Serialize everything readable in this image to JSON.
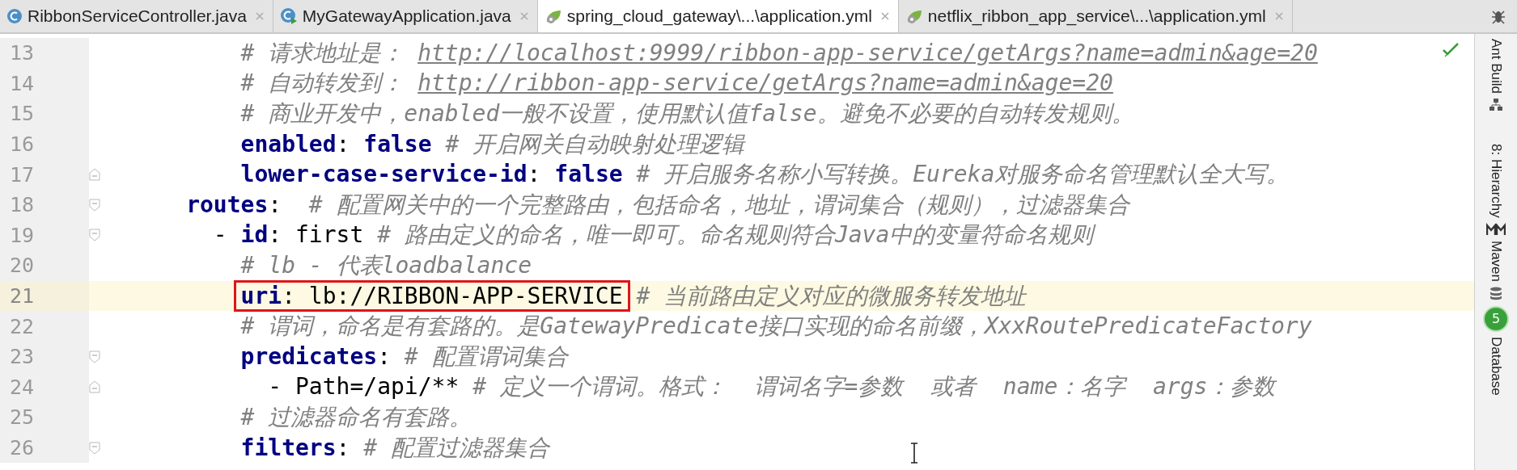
{
  "tabs": [
    {
      "label": "RibbonServiceController.java",
      "kind": "java",
      "selected": false
    },
    {
      "label": "MyGatewayApplication.java",
      "kind": "boot",
      "selected": false
    },
    {
      "label": "spring_cloud_gateway\\...\\application.yml",
      "kind": "yaml",
      "selected": true
    },
    {
      "label": "netflix_ribbon_app_service\\...\\application.yml",
      "kind": "yaml",
      "selected": false
    }
  ],
  "editor": {
    "lines": [
      {
        "number": "13",
        "current": false,
        "segments": [
          {
            "kind": "comment",
            "text": "          # 请求地址是： "
          },
          {
            "kind": "link",
            "text": "http://localhost:9999/ribbon-app-service/getArgs?name=admin&age=20"
          }
        ]
      },
      {
        "number": "14",
        "current": false,
        "segments": [
          {
            "kind": "comment",
            "text": "          # 自动转发到： "
          },
          {
            "kind": "link",
            "text": "http://ribbon-app-service/getArgs?name=admin&age=20"
          }
        ]
      },
      {
        "number": "15",
        "current": false,
        "segments": [
          {
            "kind": "comment",
            "text": "          # 商业开发中，enabled一般不设置，使用默认值false。避免不必要的自动转发规则。"
          }
        ]
      },
      {
        "number": "16",
        "current": false,
        "segments": [
          {
            "kind": "key",
            "text": "          enabled"
          },
          {
            "kind": "plain",
            "text": ": "
          },
          {
            "kind": "keyword",
            "text": "false"
          },
          {
            "kind": "comment",
            "text": " # 开启网关自动映射处理逻辑"
          }
        ]
      },
      {
        "number": "17",
        "fold_marker": {
          "kind": "end"
        },
        "current": false,
        "segments": [
          {
            "kind": "key",
            "text": "          lower-case-service-id"
          },
          {
            "kind": "plain",
            "text": ": "
          },
          {
            "kind": "keyword",
            "text": "false"
          },
          {
            "kind": "comment",
            "text": " # 开启服务名称小写转换。Eureka对服务命名管理默认全大写。"
          }
        ]
      },
      {
        "number": "18",
        "fold_marker": {
          "kind": "start"
        },
        "current": false,
        "segments": [
          {
            "kind": "key",
            "text": "      routes"
          },
          {
            "kind": "plain",
            "text": ":"
          },
          {
            "kind": "comment",
            "text": "  # 配置网关中的一个完整路由，包括命名，地址，谓词集合（规则），过滤器集合"
          }
        ]
      },
      {
        "number": "19",
        "fold_marker": {
          "kind": "start"
        },
        "current": false,
        "segments": [
          {
            "kind": "plain",
            "text": "        - "
          },
          {
            "kind": "key",
            "text": "id"
          },
          {
            "kind": "plain",
            "text": ": first"
          },
          {
            "kind": "comment",
            "text": " # 路由定义的命名，唯一即可。命名规则符合Java中的变量符命名规则"
          }
        ]
      },
      {
        "number": "20",
        "current": false,
        "segments": [
          {
            "kind": "comment",
            "text": "          # lb - 代表loadbalance"
          }
        ]
      },
      {
        "number": "21",
        "current": true,
        "segments": [
          {
            "kind": "box",
            "children": [
              {
                "kind": "key",
                "text": "uri"
              },
              {
                "kind": "plain",
                "text": ": lb://RIBBON-APP-SERVICE"
              }
            ]
          },
          {
            "kind": "comment",
            "text": " # 当前路由定义对应的微服务转发地址"
          }
        ]
      },
      {
        "number": "22",
        "current": false,
        "segments": [
          {
            "kind": "comment",
            "text": "          # 谓词，命名是有套路的。是GatewayPredicate接口实现的命名前缀，XxxRoutePredicateFactory"
          }
        ]
      },
      {
        "number": "23",
        "fold_marker": {
          "kind": "start"
        },
        "current": false,
        "segments": [
          {
            "kind": "key",
            "text": "          predicates"
          },
          {
            "kind": "plain",
            "text": ":"
          },
          {
            "kind": "comment",
            "text": " # 配置谓词集合"
          }
        ]
      },
      {
        "number": "24",
        "fold_marker": {
          "kind": "end"
        },
        "current": false,
        "segments": [
          {
            "kind": "plain",
            "text": "            - Path=/api/**"
          },
          {
            "kind": "comment",
            "text": " # 定义一个谓词。格式：  谓词名字=参数  或者  name：名字  args：参数"
          }
        ]
      },
      {
        "number": "25",
        "current": false,
        "segments": [
          {
            "kind": "comment",
            "text": "          # 过滤器命名有套路。"
          }
        ]
      },
      {
        "number": "26",
        "fold_marker": {
          "kind": "start"
        },
        "current": false,
        "segments": [
          {
            "kind": "key",
            "text": "          filters"
          },
          {
            "kind": "plain",
            "text": ":"
          },
          {
            "kind": "comment",
            "text": " # 配置过滤器集合"
          }
        ]
      }
    ]
  },
  "tool_windows": [
    {
      "label": "Ant Build",
      "kind": "ant"
    },
    {
      "label": "8: Hierarchy",
      "kind": "hierarchy"
    },
    {
      "label": "Maven",
      "kind": "maven"
    },
    {
      "label": "Database",
      "kind": "database"
    }
  ],
  "notification_badge": "5"
}
